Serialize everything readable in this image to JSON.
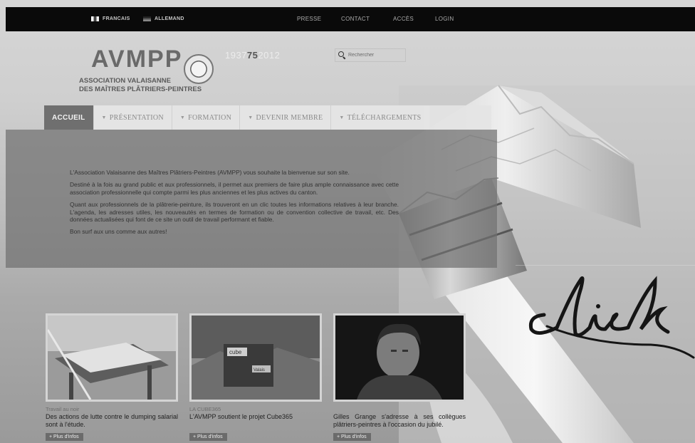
{
  "topbar": {
    "languages": [
      {
        "label": "FRANCAIS",
        "flag": "fr-flag-icon"
      },
      {
        "label": "ALLEMAND",
        "flag": "de-flag-icon"
      }
    ],
    "links": [
      "PRESSE",
      "CONTACT",
      "ACCÈS",
      "LOGIN"
    ]
  },
  "header": {
    "logo_title": "AVMPP",
    "logo_sub_line1": "ASSOCIATION VALAISANNE",
    "logo_sub_line2": "DES MAÎTRES PLÂTRIERS-PEINTRES",
    "years": {
      "start": "1937",
      "anniversary": "75",
      "end": "2012"
    },
    "search_placeholder": "Rechercher"
  },
  "nav": {
    "items": [
      {
        "label": "ACCUEIL",
        "active": true
      },
      {
        "label": "PRÉSENTATION",
        "active": false
      },
      {
        "label": "FORMATION",
        "active": false
      },
      {
        "label": "DEVENIR MEMBRE",
        "active": false
      },
      {
        "label": "TÉLÉCHARGEMENTS",
        "active": false
      }
    ]
  },
  "intro": {
    "p1": "L'Association Valaisanne des Maîtres Plâtriers-Peintres (AVMPP) vous souhaite la bienvenue sur son site.",
    "p2": "Destiné à la fois au grand public et aux professionnels, il permet aux premiers de faire plus ample connaissance avec cette association professionnelle qui compte parmi les plus anciennes et les plus actives du canton.",
    "p3": "Quant aux professionnels de la plâtrerie-peinture, ils trouveront en un clic toutes les informations relatives à leur branche. L'agenda, les adresses utiles, les nouveautés en termes de formation ou de convention collective de travail, etc. Des données actualisées qui font de ce site un outil de travail performant et fiable.",
    "p4": "Bon surf aux uns comme aux autres!"
  },
  "cards": [
    {
      "tag": "Travail au noir",
      "title": "Des actions de lutte contre le dumping salarial sont à l'étude.",
      "button": "+ Plus d'infos"
    },
    {
      "tag": "LA CUBE365",
      "title": "L'AVMPP soutient le projet Cube365",
      "button": "+ Plus d'infos"
    },
    {
      "tag": "",
      "title": "Gilles Grange s'adresse à ses collègues plâtriers-peintres à l'occasion du jubilé.",
      "button": "+ Plus d'infos"
    }
  ],
  "decor": {
    "signature_text": "click"
  },
  "colors": {
    "topbar": "#0a0a0a",
    "nav_active": "#6f6f6f",
    "band": "#707070"
  }
}
